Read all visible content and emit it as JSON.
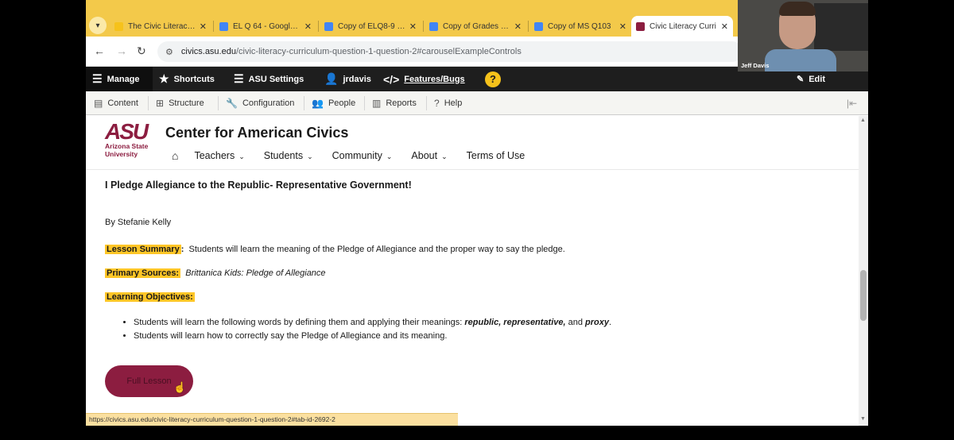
{
  "browser": {
    "tabs": [
      {
        "title": "The Civic Literacy C",
        "favicon_color": "#f6c21b",
        "active": false
      },
      {
        "title": "EL Q 64 - Google D",
        "favicon_color": "#4285f4",
        "active": false
      },
      {
        "title": "Copy of ELQ8-9 - G",
        "favicon_color": "#4285f4",
        "active": false
      },
      {
        "title": "Copy of Grades 3-5",
        "favicon_color": "#4285f4",
        "active": false
      },
      {
        "title": "Copy of MS Q103",
        "favicon_color": "#4285f4",
        "active": false
      },
      {
        "title": "Civic Literacy Curri",
        "favicon_color": "#8c1d40",
        "active": true
      }
    ],
    "url_host": "civics.asu.edu",
    "url_path": "/civic-literacy-curriculum-question-1-question-2#carouselExampleControls"
  },
  "drupal_toolbar": {
    "manage": "Manage",
    "shortcuts": "Shortcuts",
    "asu_settings": "ASU Settings",
    "user": "jrdavis",
    "features": "Features/Bugs",
    "help": "?",
    "edit": "Edit"
  },
  "admin_tray": {
    "items": [
      "Content",
      "Structure",
      "Configuration",
      "People",
      "Reports",
      "Help"
    ]
  },
  "site": {
    "logo_mark": "ASU",
    "logo_line1": "Arizona State",
    "logo_line2": "University",
    "title": "Center for American Civics",
    "nav": [
      "Teachers",
      "Students",
      "Community",
      "About",
      "Terms of Use"
    ]
  },
  "lesson": {
    "title": "I Pledge Allegiance to the Republic- Representative Government!",
    "byline": "By Stefanie Kelly",
    "summary_label": "Lesson Summary",
    "summary_colon": ":",
    "summary_text": "Students will learn the meaning of the Pledge of Allegiance and the proper way to say the pledge.",
    "sources_label": "Primary Sources:",
    "sources_text": "Brittanica Kids: Pledge of Allegiance",
    "objectives_label": "Learning Objectives:",
    "objective1_pre": "Students will learn the following words by defining them and applying their meanings: ",
    "objective1_words": "republic, representative,",
    "objective1_and": " and ",
    "objective1_last": "proxy",
    "objective1_end": ".",
    "objective2": "Students will learn how to correctly say the Pledge of Allegiance and its meaning.",
    "button": "Full Lesson"
  },
  "status_bar": {
    "url": "https://civics.asu.edu/civic-literacy-curriculum-question-1-question-2#tab-id-2692-2"
  },
  "webcam": {
    "name": "Jeff Davis"
  }
}
